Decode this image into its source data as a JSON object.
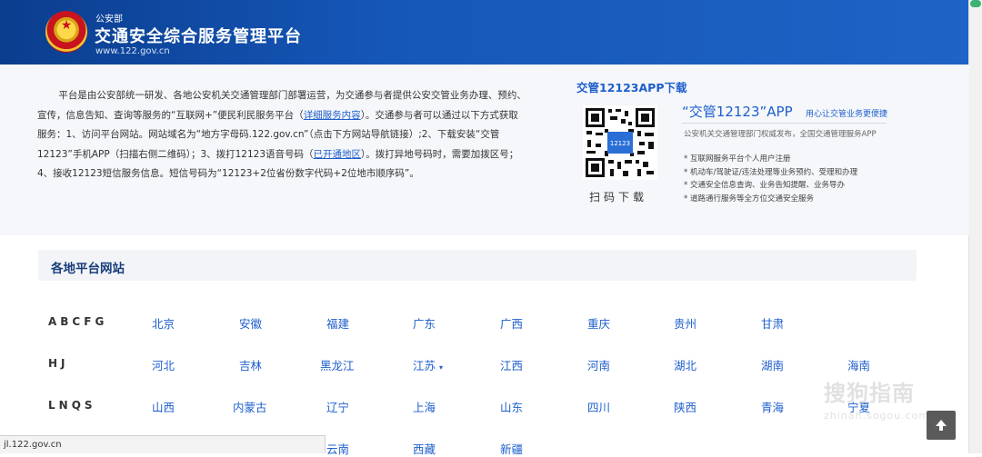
{
  "header": {
    "ministry": "公安部",
    "title": "交通安全综合服务管理平台",
    "url": "www.122.gov.cn"
  },
  "intro": {
    "part1": "平台是由公安部统一研发、各地公安机关交通管理部门部署运营，为交通参与者提供公安交管业务办理、预约、宣传，信息告知、查询等服务的“互联网+”便民利民服务平台（",
    "link1": "详细服务内容",
    "part2": "）。交通参与者可以通过以下方式获取服务：1、访问平台网站。网站域名为“地方字母码.122.gov.cn”（点击下方网站导航链接）;2、下载安装“交管12123”手机APP（扫描右侧二维码）；3、拨打12123语音号码（",
    "link2": "已开通地区",
    "part3": "）。拨打异地号码时，需要加拨区号；4、接收12123短信服务信息。短信号码为“12123+2位省份数字代码+2位地市顺序码”。"
  },
  "app": {
    "title": "交管12123APP下载",
    "qr_caption": "扫码下载",
    "qr_badge": "12123",
    "name": "“交管12123”APP",
    "slogan": "用心让交管业务更便捷",
    "desc": "公安机关交通管理部门权威发布，全国交通管理服务APP",
    "features": [
      "* 互联网服务平台个人用户注册",
      "* 机动车/驾驶证/违法处理等业务预约、受理和办理",
      "* 交通安全信息查询、业务告知提醒、业务导办",
      "* 道路通行服务等全方位交通安全服务"
    ]
  },
  "sites": {
    "title": "各地平台网站",
    "rows": [
      {
        "group": "ABCFG",
        "items": [
          "北京",
          "安徽",
          "福建",
          "广东",
          "广西",
          "重庆",
          "贵州",
          "甘肃"
        ]
      },
      {
        "group": "HJ",
        "items": [
          "河北",
          "吉林",
          "黑龙江",
          "江苏",
          "江西",
          "河南",
          "湖北",
          "湖南",
          "海南"
        ]
      },
      {
        "group": "LNQS",
        "items": [
          "山西",
          "内蒙古",
          "辽宁",
          "上海",
          "山东",
          "四川",
          "陕西",
          "青海",
          "宁夏"
        ]
      },
      {
        "group": "",
        "items": [
          "",
          "",
          "云南",
          "西藏",
          "新疆"
        ]
      }
    ],
    "dropdown_caret": "▾"
  },
  "status_bar": {
    "url": "jl.122.gov.cn"
  },
  "watermark": {
    "main": "搜狗指南",
    "sub": "zhinan.sogou.com"
  },
  "colors": {
    "header": "#1557b8",
    "link": "#1f5fcc",
    "accent": "#1a3e7a"
  }
}
